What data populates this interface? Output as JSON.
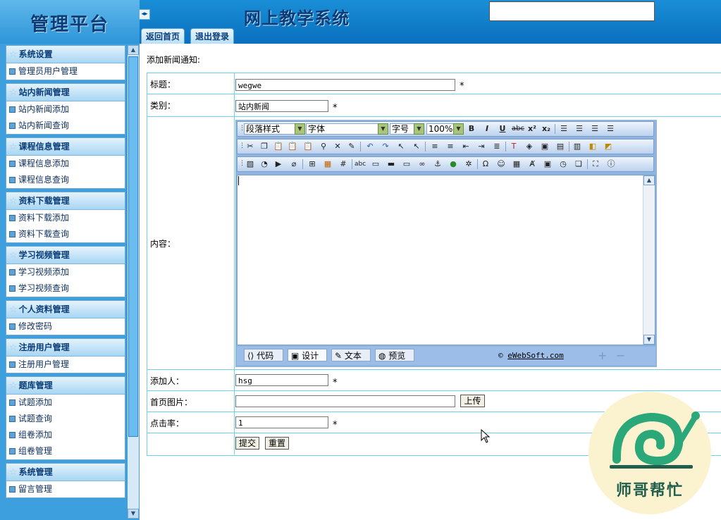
{
  "header": {
    "logo_text": "管理平台",
    "system_title": "网上教学系统",
    "tabs": [
      "返回首页",
      "退出登录"
    ]
  },
  "sidebar": {
    "sections": [
      {
        "title": "系统设置",
        "items": [
          "管理员用户管理"
        ]
      },
      {
        "title": "站内新闻管理",
        "items": [
          "站内新闻添加",
          "站内新闻查询"
        ]
      },
      {
        "title": "课程信息管理",
        "items": [
          "课程信息添加",
          "课程信息查询"
        ]
      },
      {
        "title": "资料下载管理",
        "items": [
          "资料下载添加",
          "资料下载查询"
        ]
      },
      {
        "title": "学习视频管理",
        "items": [
          "学习视频添加",
          "学习视频查询"
        ]
      },
      {
        "title": "个人资料管理",
        "items": [
          "修改密码"
        ]
      },
      {
        "title": "注册用户管理",
        "items": [
          "注册用户管理"
        ]
      },
      {
        "title": "题库管理",
        "items": [
          "试题添加",
          "试题查询",
          "组卷添加",
          "组卷管理"
        ]
      },
      {
        "title": "系统管理",
        "items": [
          "留言管理"
        ]
      }
    ]
  },
  "main": {
    "heading": "添加新闻通知:",
    "required_mark": "*",
    "fields": {
      "title": {
        "label": "标题：",
        "value": "wegwe"
      },
      "category": {
        "label": "类别：",
        "value": "站内新闻"
      },
      "content": {
        "label": "内容：",
        "value": ""
      },
      "author": {
        "label": "添加人：",
        "value": "hsg"
      },
      "image": {
        "label": "首页图片：",
        "value": "",
        "upload_label": "上传"
      },
      "clicks": {
        "label": "点击率：",
        "value": "1"
      }
    },
    "submit_label": "提交",
    "reset_label": "重置"
  },
  "editor": {
    "paragraph_style": "段落样式",
    "font": "字体",
    "font_size": "字号",
    "zoom": "100%",
    "mode_tabs": [
      "代码",
      "设计",
      "文本",
      "预览"
    ],
    "copyright_prefix": "©",
    "copyright_link": "eWebSoft.com"
  },
  "watermark": {
    "text": "师哥帮忙"
  }
}
